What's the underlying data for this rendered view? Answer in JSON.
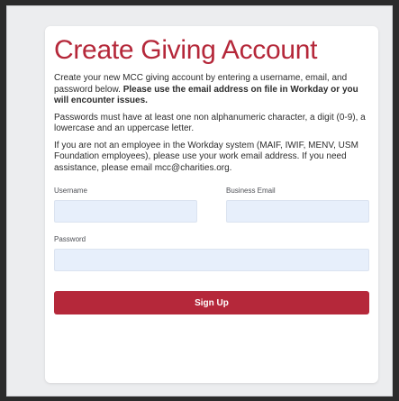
{
  "form": {
    "title": "Create Giving Account",
    "intro_plain": "Create your new MCC giving account by entering a username, email, and password below. ",
    "intro_bold": "Please use the email address on file in Workday or you will encounter issues.",
    "password_rules": "Passwords must have at least one non alphanumeric character, a digit (0-9), a lowercase and an uppercase letter.",
    "non_employee_note": "If you are not an employee in the Workday system (MAIF, IWIF, MENV, USM Foundation employees), please use your work email address. If you need assistance, please email mcc@charities.org.",
    "fields": {
      "username_label": "Username",
      "username_value": "",
      "email_label": "Business Email",
      "email_value": "",
      "password_label": "Password",
      "password_value": ""
    },
    "submit_label": "Sign Up"
  },
  "colors": {
    "accent": "#b5283a",
    "input_bg": "#e7effb",
    "page_bg": "#ecedef"
  }
}
